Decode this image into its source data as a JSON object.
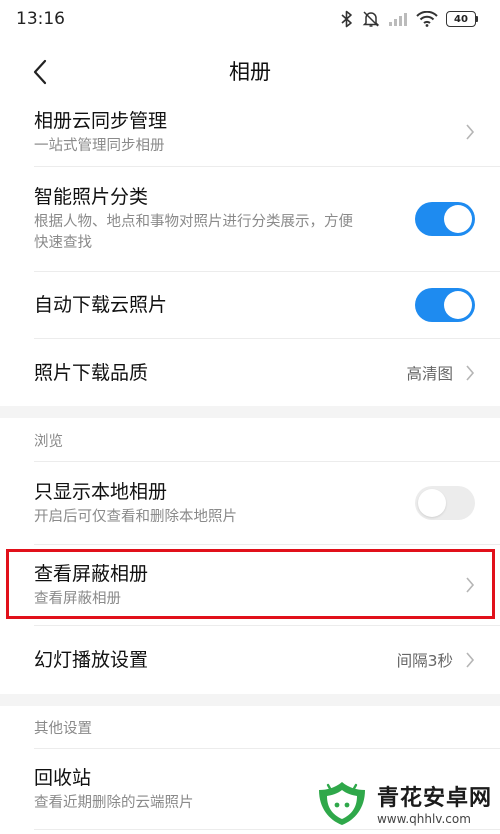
{
  "status_bar": {
    "time": "13:16",
    "battery": "40"
  },
  "header": {
    "title": "相册"
  },
  "items": [
    {
      "title": "相册云同步管理",
      "subtitle": "一站式管理同步相册"
    },
    {
      "title": "智能照片分类",
      "subtitle": "根据人物、地点和事物对照片进行分类展示，方便",
      "subtitle2": "快速查找",
      "toggle": true
    },
    {
      "title": "自动下载云照片",
      "toggle": true
    },
    {
      "title": "照片下载品质",
      "value": "高清图"
    }
  ],
  "section_browse": {
    "header": "浏览",
    "items": [
      {
        "title": "只显示本地相册",
        "subtitle": "开启后可仅查看和删除本地照片",
        "toggle": false
      },
      {
        "title": "查看屏蔽相册",
        "subtitle": "查看屏蔽相册"
      },
      {
        "title": "幻灯播放设置",
        "value": "间隔3秒"
      }
    ]
  },
  "section_other": {
    "header": "其他设置",
    "items": [
      {
        "title": "回收站",
        "subtitle": "查看近期删除的云端照片"
      }
    ]
  },
  "watermark": {
    "title": "青花安卓网",
    "url": "www.qhhlv.com"
  },
  "colors": {
    "toggle_on": "#1e8bf0",
    "toggle_off": "#ececec",
    "highlight": "#e1101a"
  }
}
